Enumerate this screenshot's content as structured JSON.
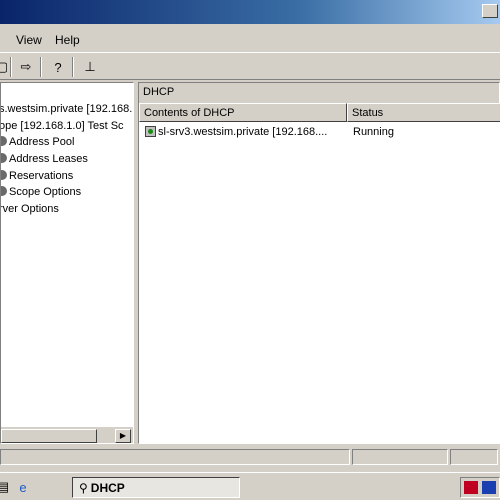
{
  "menu": {
    "view": "View",
    "help": "Help"
  },
  "tree": {
    "items": [
      "s.westsim.private [192.168.",
      "ope [192.168.1.0] Test Sc",
      "Address Pool",
      "Address Leases",
      "Reservations",
      "Scope Options",
      "rver Options"
    ]
  },
  "right": {
    "header": "DHCP",
    "columns": [
      "Contents of DHCP",
      "Status"
    ],
    "rows": [
      {
        "name": "sl-srv3.westsim.private [192.168....",
        "status": "Running"
      }
    ]
  },
  "taskbar": {
    "task_label": "DHCP"
  },
  "colors": {
    "title_start": "#0a246a",
    "title_end": "#a6caf0",
    "chrome": "#d4d0c8"
  },
  "icons": [
    "toolbar-export-icon",
    "help-icon",
    "properties-icon",
    "ie-icon",
    "dhcp-icon",
    "tray-network-icon",
    "tray-volume-icon"
  ]
}
